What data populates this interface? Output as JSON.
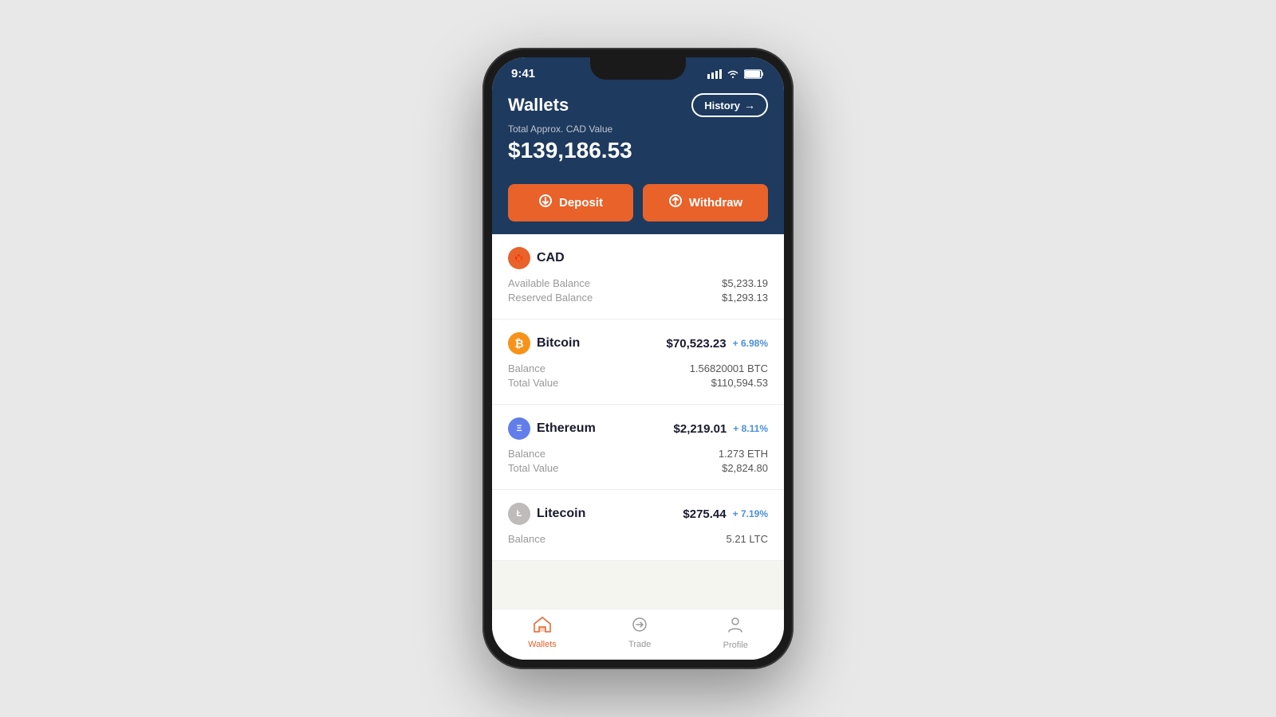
{
  "phone": {
    "status": {
      "time": "9:41",
      "signal": "▲▲▲",
      "wifi": "WiFi",
      "battery": "Battery"
    },
    "header": {
      "title": "Wallets",
      "history_btn": "History",
      "total_label": "Total Approx. CAD Value",
      "total_value": "$139,186.53"
    },
    "actions": {
      "deposit_label": "Deposit",
      "withdraw_label": "Withdraw"
    },
    "wallets": [
      {
        "id": "cad",
        "name": "CAD",
        "icon_text": "⬡",
        "icon_type": "cad",
        "show_price": false,
        "rows": [
          {
            "label": "Available Balance",
            "value": "$5,233.19"
          },
          {
            "label": "Reserved Balance",
            "value": "$1,293.13"
          }
        ]
      },
      {
        "id": "btc",
        "name": "Bitcoin",
        "icon_text": "₿",
        "icon_type": "btc",
        "show_price": true,
        "price": "$70,523.23",
        "change": "+ 6.98%",
        "rows": [
          {
            "label": "Balance",
            "value": "1.56820001 BTC"
          },
          {
            "label": "Total Value",
            "value": "$110,594.53"
          }
        ]
      },
      {
        "id": "eth",
        "name": "Ethereum",
        "icon_text": "Ξ",
        "icon_type": "eth",
        "show_price": true,
        "price": "$2,219.01",
        "change": "+ 8.11%",
        "rows": [
          {
            "label": "Balance",
            "value": "1.273 ETH"
          },
          {
            "label": "Total Value",
            "value": "$2,824.80"
          }
        ]
      },
      {
        "id": "ltc",
        "name": "Litecoin",
        "icon_text": "Ł",
        "icon_type": "ltc",
        "show_price": true,
        "price": "$275.44",
        "change": "+ 7.19%",
        "rows": [
          {
            "label": "Balance",
            "value": "5.21 LTC"
          }
        ]
      }
    ],
    "nav": {
      "items": [
        {
          "id": "wallets",
          "label": "Wallets",
          "active": true
        },
        {
          "id": "trade",
          "label": "Trade",
          "active": false
        },
        {
          "id": "profile",
          "label": "Profile",
          "active": false
        }
      ]
    }
  }
}
